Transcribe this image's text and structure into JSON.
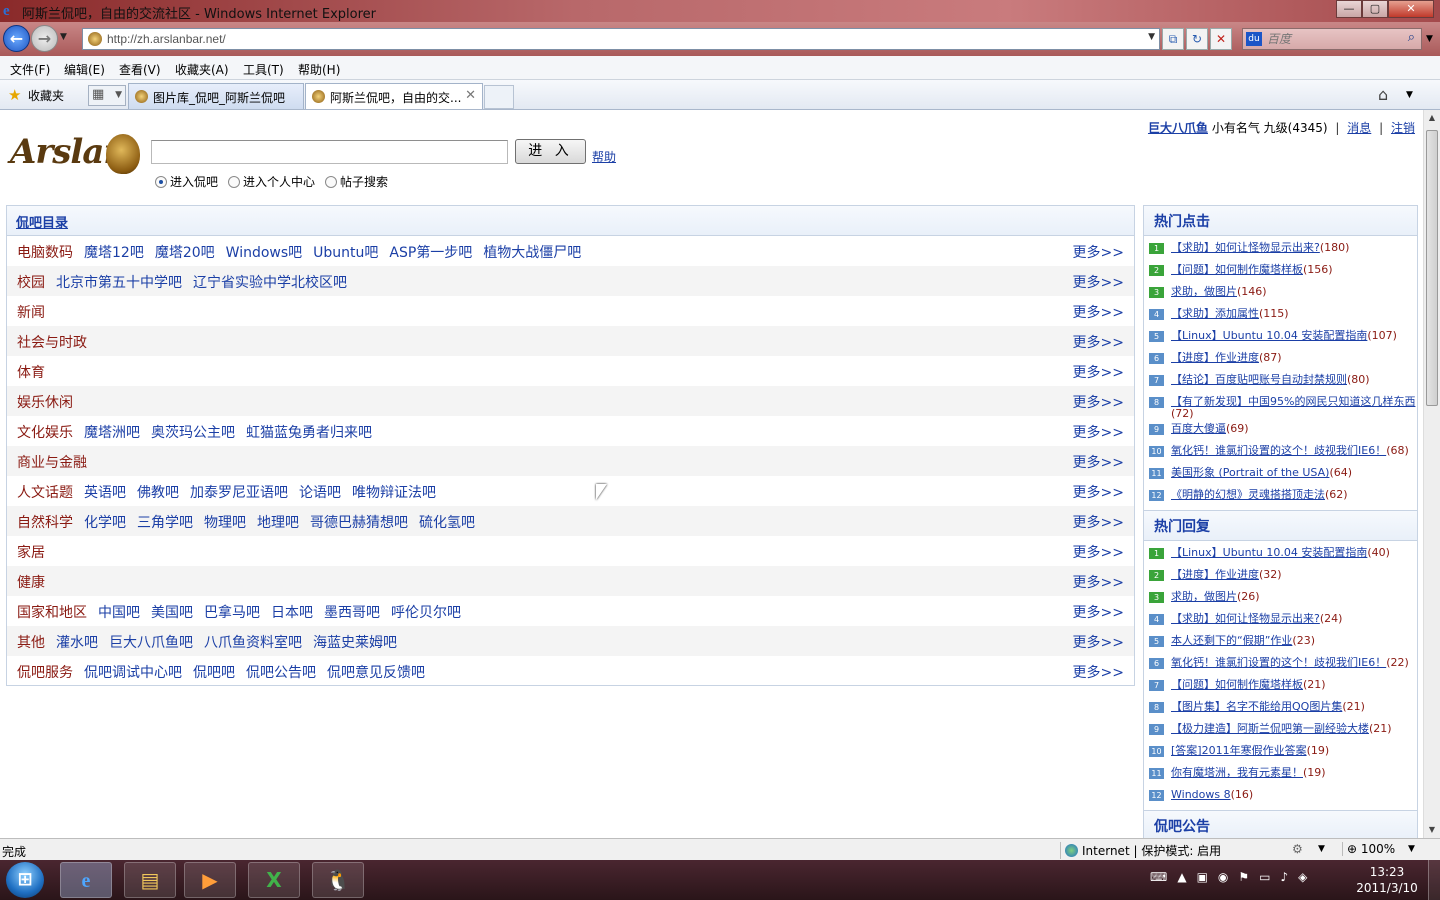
{
  "window": {
    "title": "阿斯兰侃吧，自由的交流社区 - Windows Internet Explorer",
    "buttons": {
      "minimize": "—",
      "maximize": "▢",
      "close": "✕"
    }
  },
  "navigation": {
    "url": "http://zh.arslanbar.net/",
    "search_placeholder": "百度"
  },
  "menu": [
    "文件(F)",
    "编辑(E)",
    "查看(V)",
    "收藏夹(A)",
    "工具(T)",
    "帮助(H)"
  ],
  "favorites": {
    "label": "收藏夹"
  },
  "tabs": [
    {
      "label": "图片库_侃吧_阿斯兰侃吧",
      "active": false
    },
    {
      "label": "阿斯兰侃吧，自由的交...",
      "active": true
    }
  ],
  "user": {
    "name": "巨大八爪鱼",
    "rank": "小有名气",
    "level": "九级(4345)",
    "messages": "消息",
    "logout": "注销"
  },
  "logo": {
    "text": "Arslan"
  },
  "search": {
    "button": "进 入",
    "help": "帮助",
    "options": [
      {
        "label": "进入侃吧",
        "checked": true
      },
      {
        "label": "进入个人中心",
        "checked": false
      },
      {
        "label": "帖子搜索",
        "checked": false
      }
    ]
  },
  "directory": {
    "title": "侃吧目录",
    "more": "更多>>",
    "rows": [
      {
        "category": "电脑数码",
        "bars": [
          "魔塔12吧",
          "魔塔20吧",
          "Windows吧",
          "Ubuntu吧",
          "ASP第一步吧",
          "植物大战僵尸吧"
        ]
      },
      {
        "category": "校园",
        "bars": [
          "北京市第五十中学吧",
          "辽宁省实验中学北校区吧"
        ]
      },
      {
        "category": "新闻",
        "bars": []
      },
      {
        "category": "社会与时政",
        "bars": []
      },
      {
        "category": "体育",
        "bars": []
      },
      {
        "category": "娱乐休闲",
        "bars": []
      },
      {
        "category": "文化娱乐",
        "bars": [
          "魔塔洲吧",
          "奥茨玛公主吧",
          "虹猫蓝兔勇者归来吧"
        ]
      },
      {
        "category": "商业与金融",
        "bars": []
      },
      {
        "category": "人文话题",
        "bars": [
          "英语吧",
          "佛教吧",
          "加泰罗尼亚语吧",
          "论语吧",
          "唯物辩证法吧"
        ]
      },
      {
        "category": "自然科学",
        "bars": [
          "化学吧",
          "三角学吧",
          "物理吧",
          "地理吧",
          "哥德巴赫猜想吧",
          "硫化氢吧"
        ]
      },
      {
        "category": "家居",
        "bars": []
      },
      {
        "category": "健康",
        "bars": []
      },
      {
        "category": "国家和地区",
        "bars": [
          "中国吧",
          "美国吧",
          "巴拿马吧",
          "日本吧",
          "墨西哥吧",
          "呼伦贝尔吧"
        ]
      },
      {
        "category": "其他",
        "bars": [
          "灌水吧",
          "巨大八爪鱼吧",
          "八爪鱼资料室吧",
          "海蓝史莱姆吧"
        ]
      },
      {
        "category": "侃吧服务",
        "bars": [
          "侃吧调试中心吧",
          "侃吧吧",
          "侃吧公告吧",
          "侃吧意见反馈吧"
        ]
      }
    ]
  },
  "hot_clicks": {
    "title": "热门点击",
    "items": [
      {
        "num": "1",
        "title": "【求助】如何让怪物显示出来?",
        "count": "(180)"
      },
      {
        "num": "2",
        "title": "【问题】如何制作魔塔样板",
        "count": "(156)"
      },
      {
        "num": "3",
        "title": "求助，做图片",
        "count": "(146)"
      },
      {
        "num": "4",
        "title": "【求助】添加属性",
        "count": "(115)"
      },
      {
        "num": "5",
        "title": "【Linux】Ubuntu 10.04 安装配置指南",
        "count": "(107)"
      },
      {
        "num": "6",
        "title": "【进度】作业进度",
        "count": "(87)"
      },
      {
        "num": "7",
        "title": "【结论】百度贴吧账号自动封禁规则",
        "count": "(80)"
      },
      {
        "num": "8",
        "title": "【有了新发现】中国95%的网民只知道这几样东西",
        "count": "(72)"
      },
      {
        "num": "9",
        "title": "百度大傻逼",
        "count": "(69)"
      },
      {
        "num": "10",
        "title": "氧化钙！谁氯扪设置的这个！歧视我们IE6！",
        "count": "(68)"
      },
      {
        "num": "11",
        "title": "美国形象 (Portrait of the USA)",
        "count": "(64)"
      },
      {
        "num": "12",
        "title": "《明静的幻想》灵魂搭搭顶走法",
        "count": "(62)"
      }
    ]
  },
  "hot_replies": {
    "title": "热门回复",
    "items": [
      {
        "num": "1",
        "title": "【Linux】Ubuntu 10.04 安装配置指南",
        "count": "(40)"
      },
      {
        "num": "2",
        "title": "【进度】作业进度",
        "count": "(32)"
      },
      {
        "num": "3",
        "title": "求助，做图片",
        "count": "(26)"
      },
      {
        "num": "4",
        "title": "【求助】如何让怪物显示出来?",
        "count": "(24)"
      },
      {
        "num": "5",
        "title": "本人还剩下的“假期”作业",
        "count": "(23)"
      },
      {
        "num": "6",
        "title": "氧化钙！谁氯扪设置的这个！歧视我们IE6！",
        "count": "(22)"
      },
      {
        "num": "7",
        "title": "【问题】如何制作魔塔样板",
        "count": "(21)"
      },
      {
        "num": "8",
        "title": "【图片集】名字不能给用QQ图片集",
        "count": "(21)"
      },
      {
        "num": "9",
        "title": "【极力建造】阿斯兰侃吧第一副经验大楼",
        "count": "(21)"
      },
      {
        "num": "10",
        "title": "[答案]2011年寒假作业答案",
        "count": "(19)"
      },
      {
        "num": "11",
        "title": "你有魔塔洲，我有元素星！",
        "count": "(19)"
      },
      {
        "num": "12",
        "title": "Windows 8",
        "count": "(16)"
      }
    ]
  },
  "announcements": {
    "title": "侃吧公告"
  },
  "status": {
    "text": "完成",
    "zone": "Internet | 保护模式: 启用",
    "zoom": "100%"
  },
  "taskbar": {
    "time": "13:23",
    "date": "2011/3/10"
  },
  "colors": {
    "link": "#1b3fa6",
    "category": "#8a1a12",
    "count": "#8a1a12",
    "green_badge": "#3aa43a",
    "blue_badge": "#5a8fc9"
  }
}
